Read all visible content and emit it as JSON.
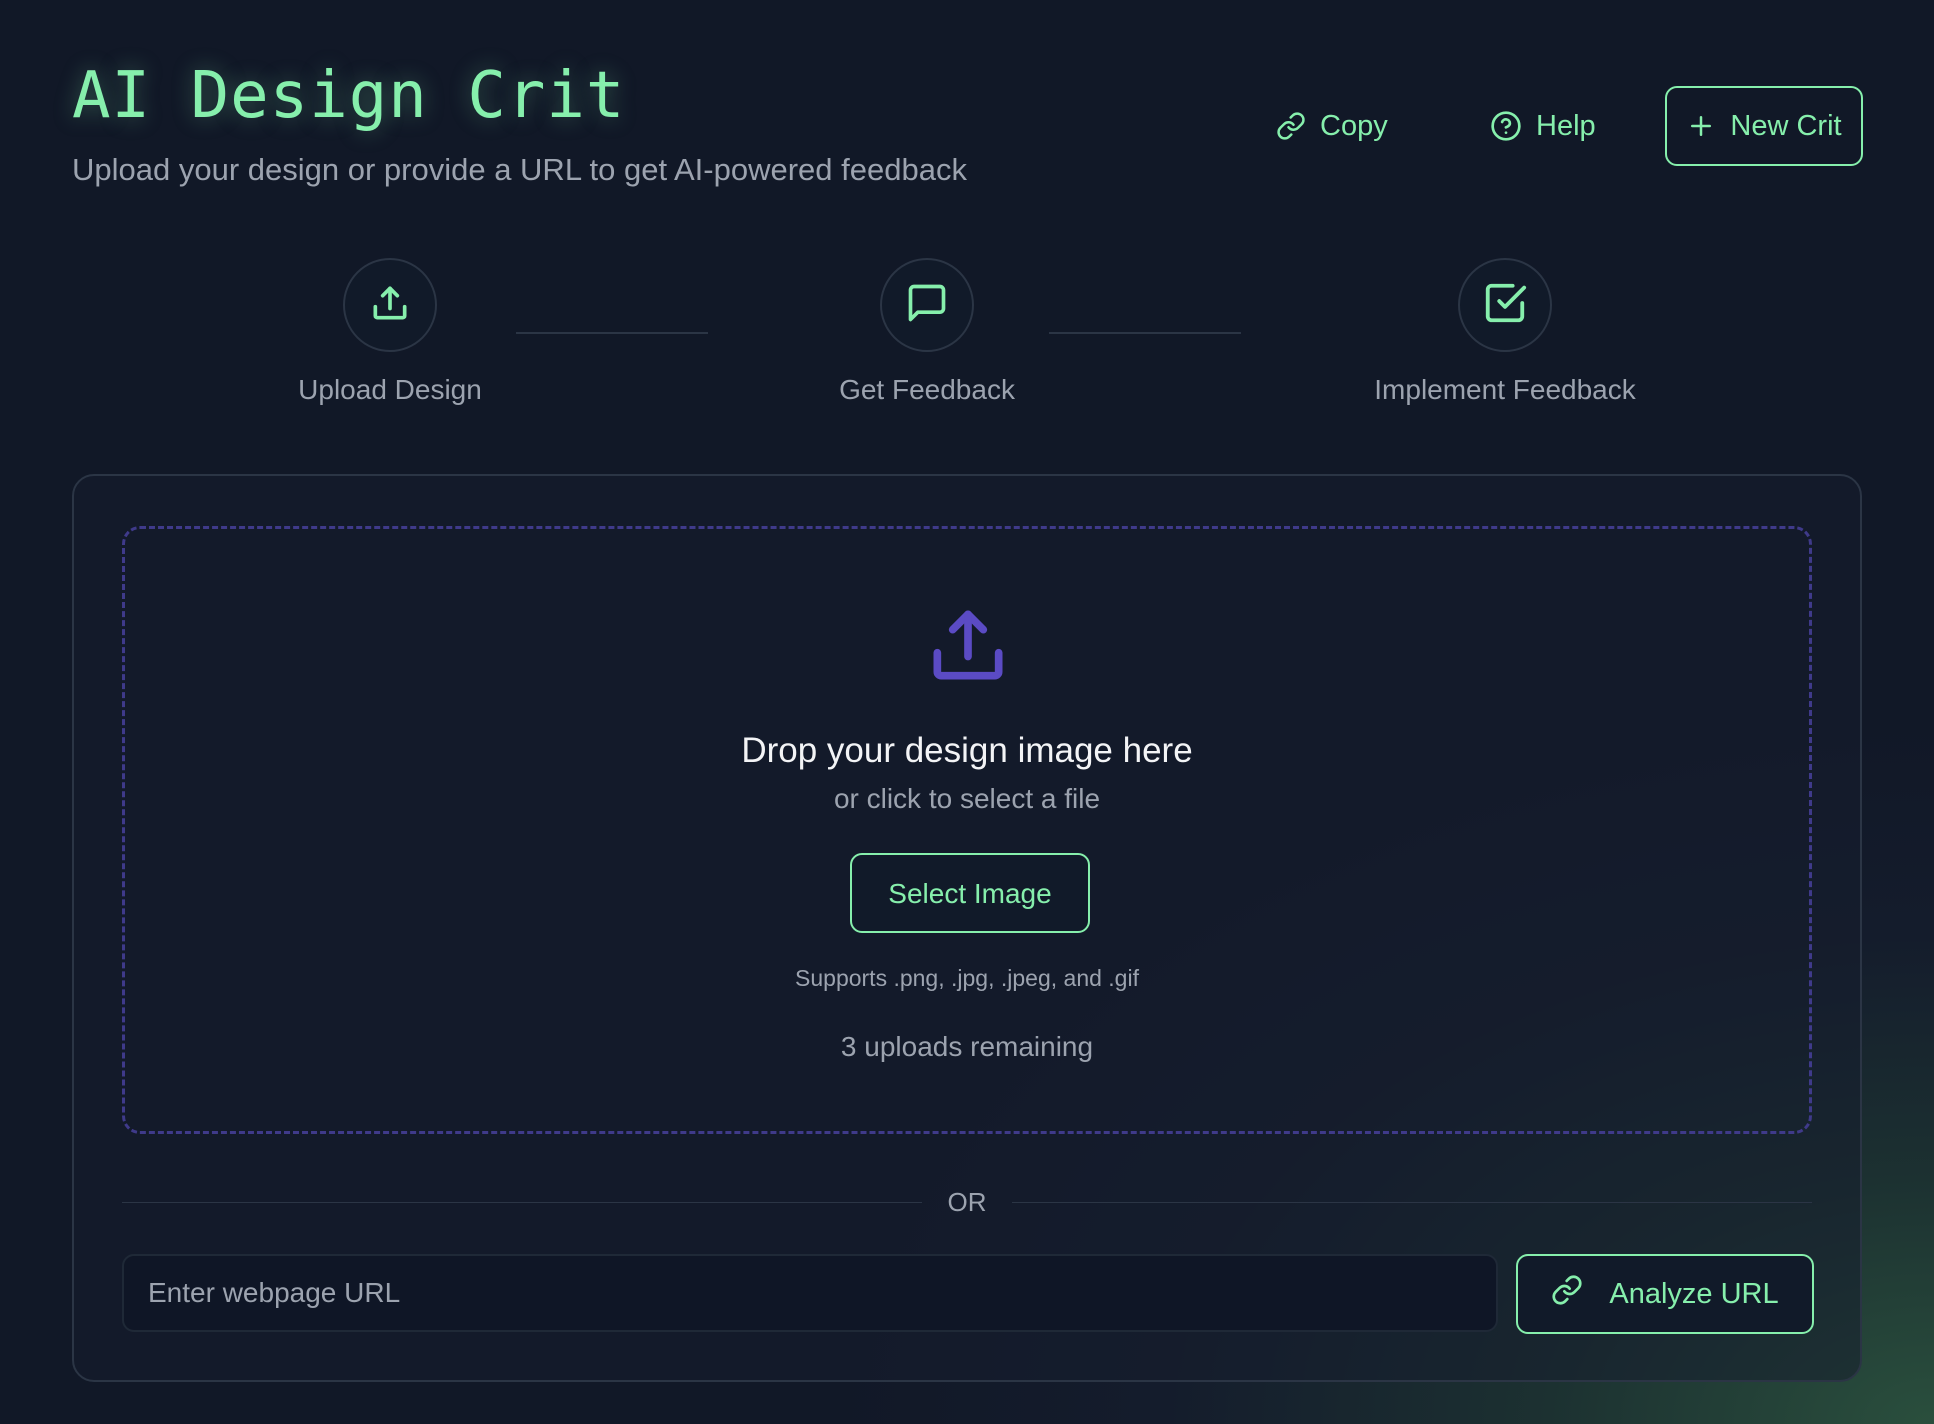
{
  "header": {
    "title": "AI Design Crit",
    "subtitle": "Upload your design or provide a URL to get AI-powered feedback",
    "actions": {
      "copy_label": "Copy",
      "copy_icon": "link-icon",
      "help_label": "Help",
      "help_icon": "help-circle-icon",
      "new_label": "New Crit",
      "new_icon": "plus-icon"
    }
  },
  "steps": [
    {
      "label": "Upload Design",
      "icon": "upload-icon"
    },
    {
      "label": "Get Feedback",
      "icon": "message-square-icon"
    },
    {
      "label": "Implement Feedback",
      "icon": "check-square-icon"
    }
  ],
  "upload": {
    "icon": "upload-icon",
    "title": "Drop your design image here",
    "subtitle": "or click to select a file",
    "button_label": "Select Image",
    "supports": "Supports .png, .jpg, .jpeg, and .gif",
    "remaining": "3 uploads remaining"
  },
  "divider_label": "OR",
  "url_form": {
    "placeholder": "Enter webpage URL",
    "value": "",
    "button_label": "Analyze URL",
    "button_icon": "link-icon"
  },
  "colors": {
    "accent": "#86efac",
    "dropzone_border": "#3f3a8a",
    "upload_icon": "#5b4bc4",
    "background": "#111827"
  }
}
